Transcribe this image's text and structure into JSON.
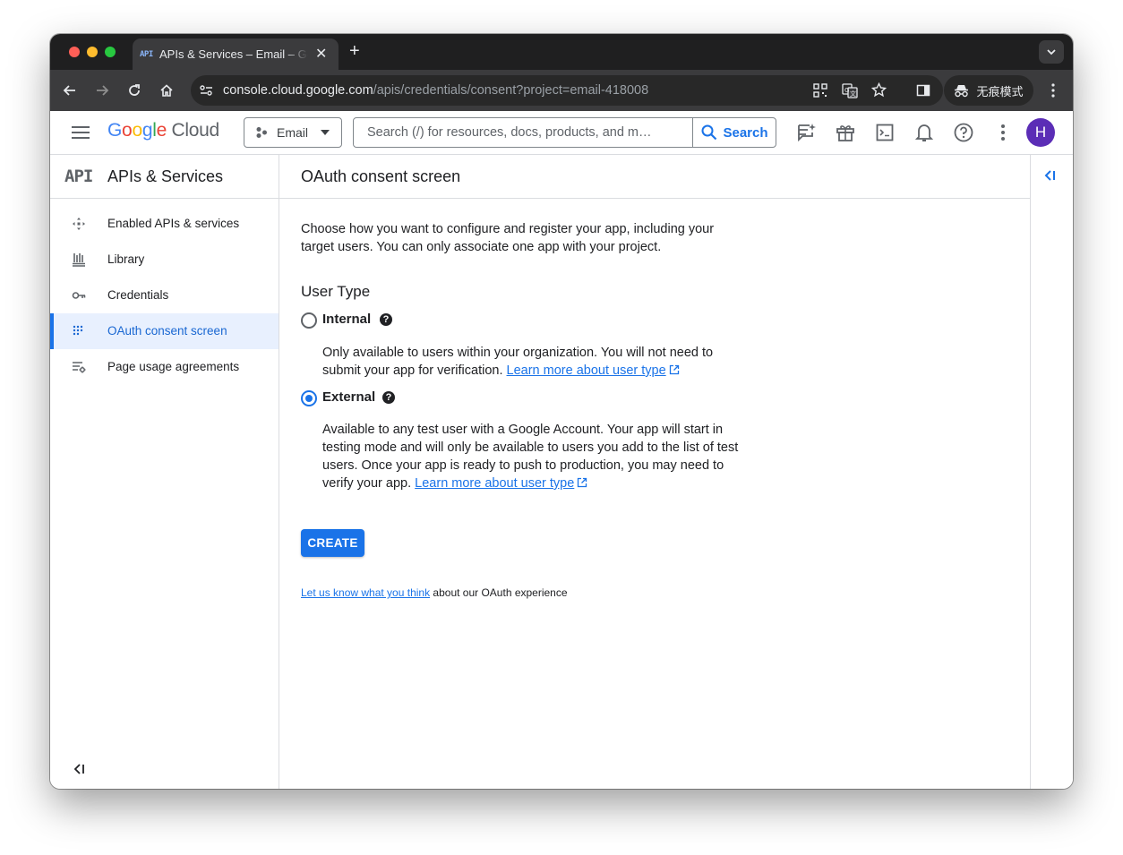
{
  "browser": {
    "tab": {
      "favicon": "API",
      "title": "APIs & Services – Email – Google Cloud console"
    },
    "url": {
      "host": "console.cloud.google.com",
      "path": "/apis/credentials/consent?project=email-418008"
    },
    "incognito_label": "无痕模式"
  },
  "header": {
    "logo": {
      "g": [
        "G",
        "o",
        "o",
        "g",
        "l",
        "e"
      ],
      "cloud": "Cloud"
    },
    "project": "Email",
    "search_placeholder": "Search (/) for resources, docs, products, and m…",
    "search_label": "Search",
    "avatar_letter": "H"
  },
  "sidebar": {
    "api_badge": "API",
    "title": "APIs & Services",
    "items": [
      {
        "label": "Enabled APIs & services",
        "icon": "apis-icon",
        "active": false
      },
      {
        "label": "Library",
        "icon": "library-icon",
        "active": false
      },
      {
        "label": "Credentials",
        "icon": "key-icon",
        "active": false
      },
      {
        "label": "OAuth consent screen",
        "icon": "consent-icon",
        "active": true
      },
      {
        "label": "Page usage agreements",
        "icon": "settings-list-icon",
        "active": false
      }
    ]
  },
  "main": {
    "title": "OAuth consent screen",
    "intro_line1": "Choose how you want to configure and register your app, including your",
    "intro_line2": "target users. You can only associate one app with your project.",
    "user_type_heading": "User Type",
    "internal": {
      "label": "Internal",
      "selected": false,
      "desc_line1": "Only available to users within your organization. You will not need to",
      "desc_line2": "submit your app for verification.",
      "link": "Learn more about user type"
    },
    "external": {
      "label": "External",
      "selected": true,
      "desc_line1": "Available to any test user with a Google Account. Your app will start in",
      "desc_line2": "testing mode and will only be available to users you add to the list of test",
      "desc_line3": "users. Once your app is ready to push to production, you may need to",
      "desc_line4": "verify your app.",
      "link": "Learn more about user type"
    },
    "create_label": "CREATE",
    "feedback_link": "Let us know what you think",
    "feedback_rest": " about our OAuth experience"
  },
  "colors": {
    "accent": "#1a73e8",
    "avatar": "#5b2db6",
    "active_bg": "#e8f0fe"
  }
}
